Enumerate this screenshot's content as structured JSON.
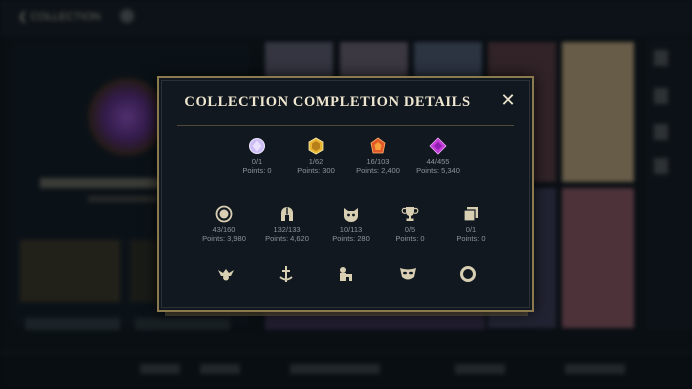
{
  "background": {
    "top_bar": {
      "back_label": "COLLECTION"
    }
  },
  "modal": {
    "title": "COLLECTION COMPLETION DETAILS",
    "close_icon": "close-icon",
    "row1": [
      {
        "icon": "crystal-white-icon",
        "count": "0/1",
        "points": "Points: 0",
        "color": "#c8b6f2"
      },
      {
        "icon": "crystal-gold-icon",
        "count": "1/62",
        "points": "Points: 300",
        "color": "#e6b53a"
      },
      {
        "icon": "crystal-orange-icon",
        "count": "16/103",
        "points": "Points: 2,400",
        "color": "#e2592a"
      },
      {
        "icon": "crystal-purple-icon",
        "count": "44/455",
        "points": "Points: 5,340",
        "color": "#c13bd6"
      }
    ],
    "row2": [
      {
        "icon": "circle-token-icon",
        "count": "43/160",
        "points": "Points: 3,980"
      },
      {
        "icon": "helmet-icon",
        "count": "132/133",
        "points": "Points: 4,620"
      },
      {
        "icon": "poro-icon",
        "count": "10/113",
        "points": "Points: 280"
      },
      {
        "icon": "trophy-icon",
        "count": "0/5",
        "points": "Points: 0"
      },
      {
        "icon": "cards-icon",
        "count": "0/1",
        "points": "Points: 0"
      }
    ],
    "row3_icons": [
      "emote-icon",
      "ward-icon",
      "companion-icon",
      "mask-icon",
      "ring-icon"
    ]
  },
  "colors": {
    "frame_gold": "#8c7a4f",
    "text_cream": "#efe7d0",
    "icon_beige": "#d8cfb2",
    "muted_text": "#8e949a"
  }
}
